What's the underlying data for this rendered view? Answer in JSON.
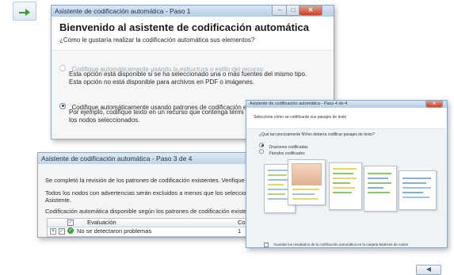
{
  "top_icon": {
    "name": "arrow-right-icon"
  },
  "window1": {
    "title": "Asistente de codificación automática - Paso 1",
    "heading": "Bienvenido al asistente de codificación automática",
    "question": "¿Cómo le gustaría realizar la codificación automática sus elementos?",
    "option1_label": "Codifique automáticamente usando la estructura o estilo del recurso",
    "option1_desc1": "Esta opción está disponible si se ha seleccionado una o más fuentes del mismo tipo.",
    "option1_desc2": "Esta opción no está disponible para archivos en PDF o imágenes.",
    "option2_label": "Codifique automáticamente usando patrones de codificación existentes",
    "option2_desc1": "Por ejemplo, codifique texto en un recurso que contenga términos similares",
    "option2_desc2": "los nodos seleccionados."
  },
  "window3": {
    "title": "Asistente de codificación automática - Paso 3 de 4",
    "line1": "Se completó la revisión de los patrones de codificación existentes. Verifique la s",
    "line2": "Todos los nodos con advertencias serán excluidos a menos que los seleccione r",
    "line3": "Asistente.",
    "line4": "Codificación automática disponible según los patrones de codificación existentes",
    "grid": {
      "col_eval": "Evaluación",
      "col_co": "Co",
      "row_text": "No se detectaron problemas",
      "row_val": "1"
    }
  },
  "window4": {
    "title": "Asistente de codificación automática - Paso 4 de 4",
    "subtitle": "Seleccione cómo se codificarán sus pasajes de texto",
    "question": "¿Qué tan precisamente NVivo debería codificar pasajes de texto?",
    "radio1": "Oraciones codificadas",
    "radio2": "Párrafos codificados",
    "checkbox": "Guardar los resultados de la codificación automática en la carpeta Matrices de nodos"
  },
  "colors": {
    "titlebar": "#c5d7ea",
    "highlight_yellow": "#e7d76a",
    "highlight_green": "#8fc46b",
    "highlight_blue": "#7fb1d9"
  },
  "bottom_button": {
    "icon": "chevron-left-icon"
  }
}
